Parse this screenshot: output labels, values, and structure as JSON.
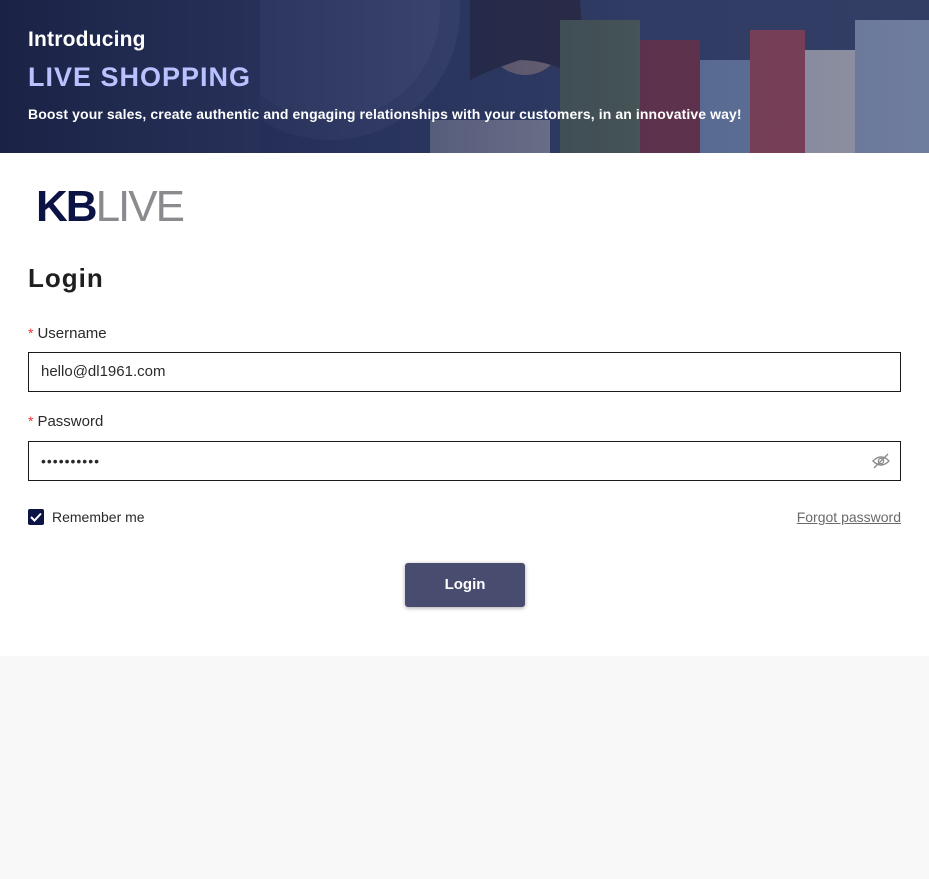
{
  "hero": {
    "intro": "Introducing",
    "title": "LIVE SHOPPING",
    "subtitle": "Boost your sales, create authentic and engaging relationships with your customers, in an innovative way!"
  },
  "logo": {
    "part1": "KB",
    "part2": "LIVE"
  },
  "form": {
    "title": "Login",
    "username_label": "Username",
    "username_value": "hello@dl1961.com",
    "password_label": "Password",
    "password_value": "••••••••••",
    "required_mark": "*",
    "remember_label": "Remember me",
    "remember_checked": true,
    "forgot_label": "Forgot password",
    "submit_label": "Login"
  },
  "colors": {
    "brand_navy": "#0c1445",
    "accent_lavender": "#b9c2ff",
    "button": "#484c6e",
    "required": "#e3342f"
  },
  "icons": {
    "password_toggle": "eye-slash-icon",
    "checkbox": "checkmark-icon"
  }
}
